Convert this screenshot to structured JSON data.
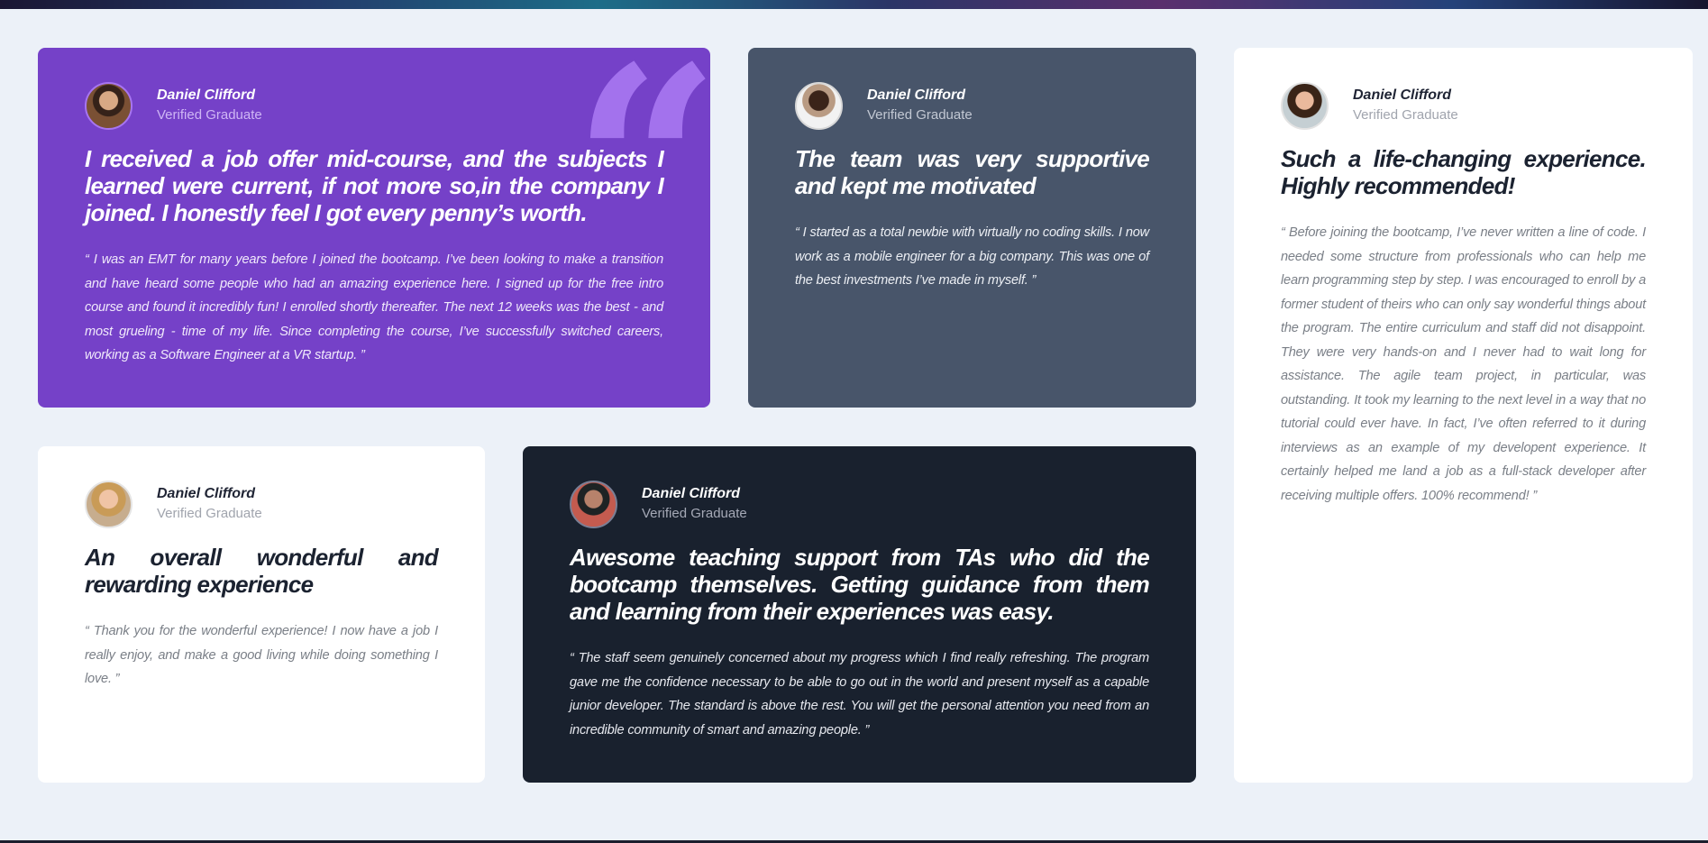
{
  "testimonials": [
    {
      "name": "Daniel Clifford",
      "role": "Verified Graduate",
      "headline": "I received a job offer mid-course, and the subjects I learned were current, if not more so,in the company I joined. I honestly feel I got every penny’s worth.",
      "body": "“ I was an EMT for many years before I joined the bootcamp. I’ve been looking to make a transition and have heard some people who had an amazing experience here. I signed up for the free intro course and found it incredibly fun! I enrolled shortly thereafter. The next 12 weeks was the best - and most grueling - time of my life. Since completing the course, I’ve successfully switched careers, working as a Software Engineer at a VR startup. ”"
    },
    {
      "name": "Daniel Clifford",
      "role": "Verified Graduate",
      "headline": "The team was very supportive and kept me motivated",
      "body": "“ I started as a total newbie with virtually no coding skills. I now work as a mobile engineer for a big company. This was one of the best investments I’ve made in myself. ”"
    },
    {
      "name": "Daniel Clifford",
      "role": "Verified Graduate",
      "headline": "Such a life-changing experience. Highly recommended!",
      "body": "“ Before joining the bootcamp, I’ve never written a line of code. I needed some structure from professionals who can help me learn programming step by step. I was encouraged to enroll by a former student of theirs who can only say wonderful things about the program. The entire curriculum and staff did not disappoint. They were very hands-on and I never had to wait long for assistance. The agile team project, in particular, was outstanding. It took my learning to the next level in a way that no tutorial could ever have. In fact, I’ve often referred to it during interviews as an example of my developent experience. It certainly helped me land a job as a full-stack developer after receiving multiple offers. 100% recommend! ”"
    },
    {
      "name": "Daniel Clifford",
      "role": "Verified Graduate",
      "headline": "An overall wonderful and rewarding experience",
      "body": "“ Thank you for the wonderful experience! I now have a job I really enjoy, and make a good living while doing something I love. ”"
    },
    {
      "name": "Daniel Clifford",
      "role": "Verified Graduate",
      "headline": "Awesome teaching support from TAs who did the bootcamp themselves. Getting guidance from them and learning from their experiences was easy.",
      "body": "“ The staff seem genuinely concerned about my progress which I find really refreshing. The program gave me the confidence necessary to be able to go out in the world and present myself as a capable junior developer. The standard is above the rest. You will get the personal attention you need from an incredible community of smart and amazing people. ”"
    }
  ],
  "colors": {
    "purple_card": "#7541c8",
    "gray_card": "#48556a",
    "white_card": "#ffffff",
    "dark_card": "#19212e",
    "page_background": "#ecf1f8"
  },
  "icons": {
    "decorative_quote": "quotation-mark-icon"
  }
}
